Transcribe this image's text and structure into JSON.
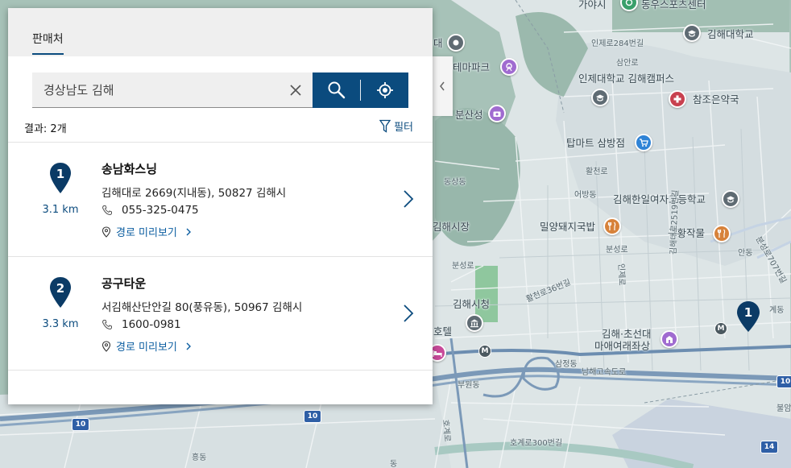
{
  "panel": {
    "tab_label": "판매처",
    "search": {
      "value": "경상남도 김해",
      "placeholder": ""
    },
    "result_count": "결과: 2개",
    "filter_label": "필터",
    "results": [
      {
        "number": "1",
        "distance": "3.1 km",
        "name": "송남화스닝",
        "address": "김해대로 2669(지내동), 50827 김해시",
        "phone": "055-325-0475",
        "route_label": "경로 미리보기"
      },
      {
        "number": "2",
        "distance": "3.3 km",
        "name": "공구타운",
        "address": "서김해산단안길 80(풍유동), 50967 김해시",
        "phone": "1600-0981",
        "route_label": "경로 미리보기"
      }
    ]
  },
  "map": {
    "labels": {
      "l1": "가야시",
      "l2": "동우스포츠센터",
      "l3": "인제로284번길",
      "l4": "김해대학교",
      "l5": "삼안로",
      "l6": "인제대학교 김해캠퍼스",
      "l7": "참조은약국",
      "l8": "테마파크",
      "l9": "분산성",
      "l10": "탑마트 삼방점",
      "l11": "활천로",
      "l12": "동상동",
      "l13": "어방동",
      "l14": "김해한일여자고등학교",
      "l15": "김해시장",
      "l16": "밀양돼지국밥",
      "l17": "구황작물",
      "l18": "분성로",
      "l19": "분성로",
      "l20": "활천로36번길",
      "l21": "인제로",
      "l22": "김해대로2519번길",
      "l23": "김해시청",
      "l24": "호텔",
      "l25": "김해·초선대",
      "l26": "마애여래좌상",
      "l27": "삼정동",
      "l28": "남해고속도로",
      "l29": "부원동",
      "l30": "호계로",
      "l31": "호계로300번길",
      "l32": "흥동",
      "l33": "안동",
      "l34": "분성로707번길",
      "l35": "불암",
      "l36": "대",
      "l37": "동",
      "l38": "김해대로",
      "l39": "계동"
    },
    "shields": {
      "s1": "10",
      "s2": "10",
      "s3": "10",
      "s4": "14",
      "m1": "M",
      "m2": "M"
    },
    "marker_number": "1"
  },
  "colors": {
    "accent": "#0b4b7e",
    "link": "#0b5da0",
    "map_water": "#a8c9c2"
  }
}
